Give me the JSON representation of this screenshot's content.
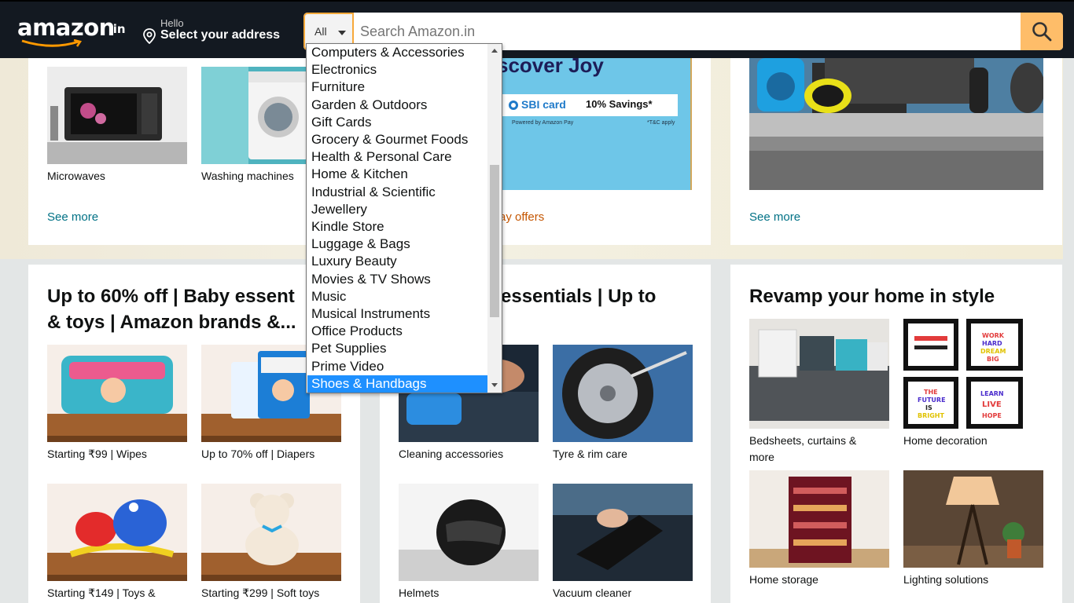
{
  "header": {
    "logo_text": "amazon",
    "logo_suffix": ".in",
    "hello": "Hello",
    "address_label": "Select your address",
    "search_category": "All",
    "search_placeholder": "Search Amazon.in"
  },
  "dropdown": {
    "items": [
      "Computers & Accessories",
      "Electronics",
      "Furniture",
      "Garden & Outdoors",
      "Gift Cards",
      "Grocery & Gourmet Foods",
      "Health & Personal Care",
      "Home & Kitchen",
      "Industrial & Scientific",
      "Jewellery",
      "Kindle Store",
      "Luggage & Bags",
      "Luxury Beauty",
      "Movies & TV Shows",
      "Music",
      "Musical Instruments",
      "Office Products",
      "Pet Supplies",
      "Prime Video",
      "Shoes & Handbags"
    ],
    "selected": "Shoes & Handbags"
  },
  "cards": {
    "appliances": {
      "tiles": [
        "Microwaves",
        "Washing machines"
      ],
      "see_more": "See more"
    },
    "promo": {
      "banner_heading": "scover Joy",
      "sbi_label": "SBI card",
      "savings": "10% Savings*",
      "powered": "Powered by Amazon Pay",
      "tnc": "*T&C apply",
      "link": "ay offers"
    },
    "electronics": {
      "see_more": "See more"
    },
    "baby": {
      "title": "Up to 60% off | Baby essent & toys | Amazon brands &...",
      "tiles": [
        "Starting ₹99 | Wipes",
        "Up to 70% off | Diapers",
        "Starting ₹149 | Toys &",
        "Starting ₹299 | Soft toys"
      ]
    },
    "car": {
      "title": "e essentials | Up to",
      "tiles": [
        "Cleaning accessories",
        "Tyre & rim care",
        "Helmets",
        "Vacuum cleaner"
      ]
    },
    "home": {
      "title": "Revamp your home in style",
      "tiles": [
        "Bedsheets, curtains & more",
        "Home decoration",
        "Home storage",
        "Lighting solutions"
      ],
      "frame_texts": [
        "WORK HARD DREAM BIG",
        "THE FUTURE IS BRIGHT",
        "LEARN LIVE HOPE"
      ]
    }
  },
  "colors": {
    "header_bg": "#131921",
    "search_button": "#febd69",
    "link": "#007185",
    "link_orange": "#c45500",
    "selected": "#1e90ff"
  }
}
